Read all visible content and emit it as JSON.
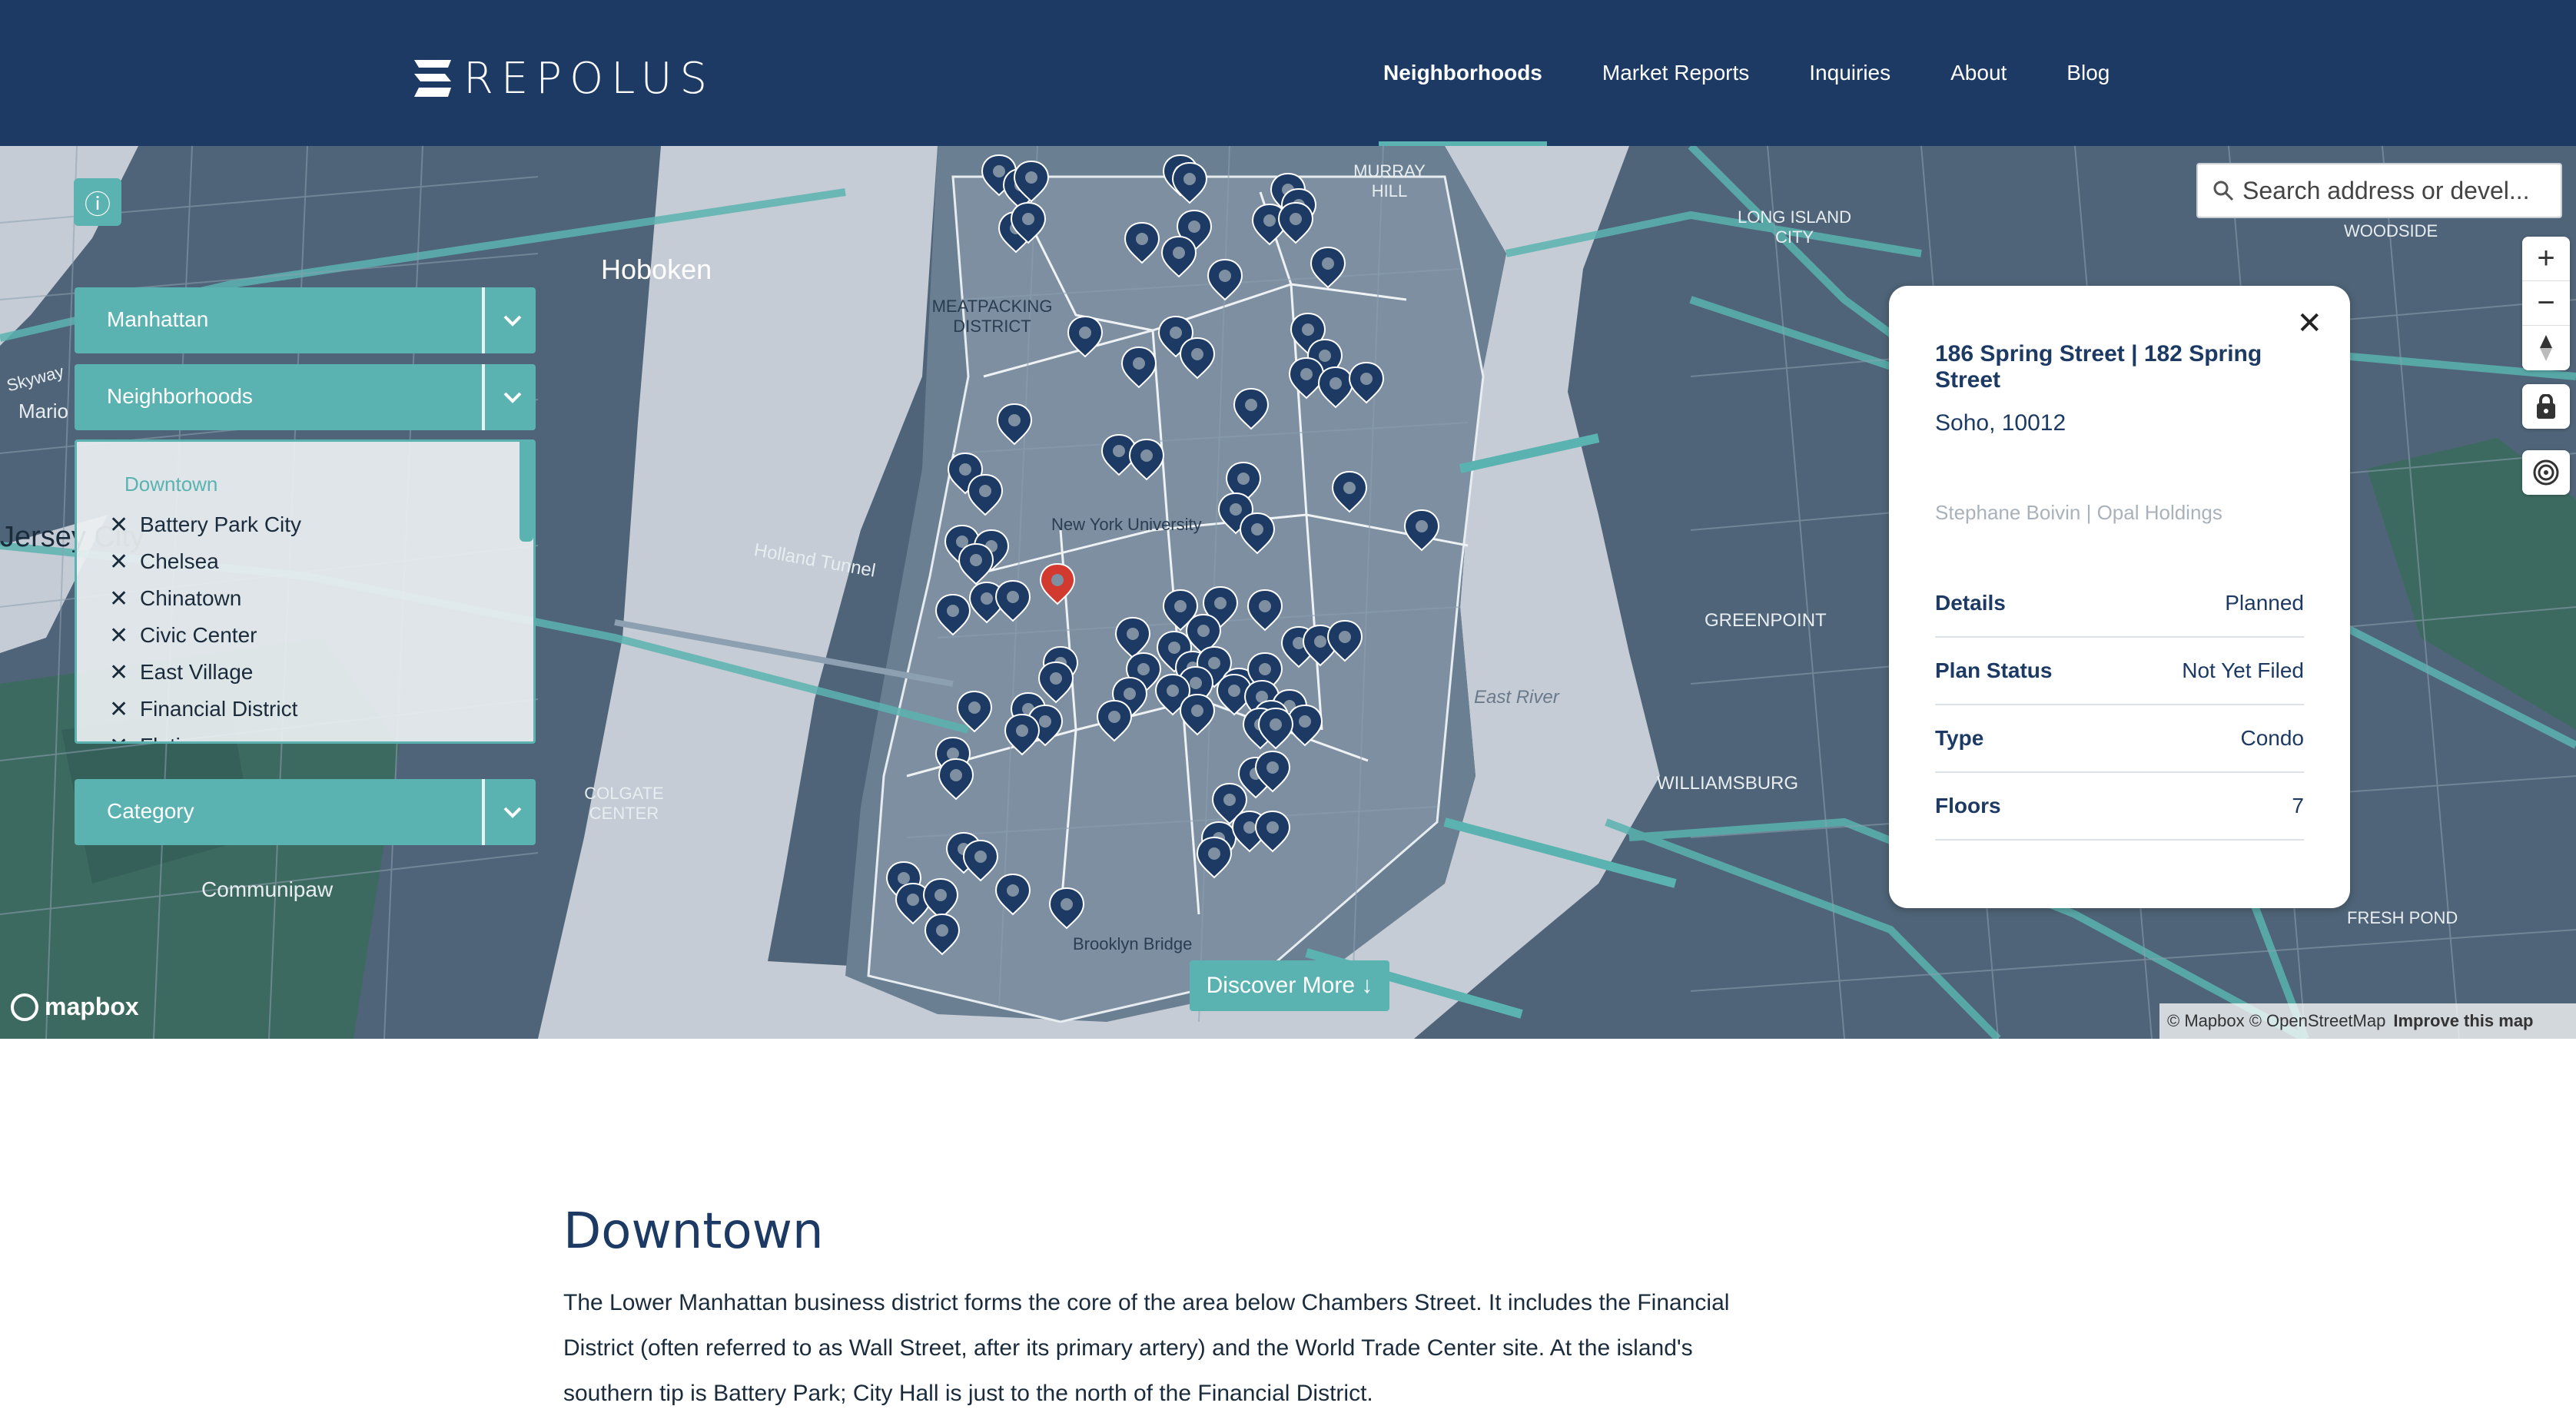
{
  "header": {
    "brand": "REPOLUS",
    "nav": [
      {
        "label": "Neighborhoods",
        "active": true
      },
      {
        "label": "Market Reports",
        "active": false
      },
      {
        "label": "Inquiries",
        "active": false
      },
      {
        "label": "About",
        "active": false
      },
      {
        "label": "Blog",
        "active": false
      }
    ]
  },
  "map": {
    "filters": {
      "borough": "Manhattan",
      "neighborhoods": "Neighborhoods",
      "category": "Category"
    },
    "neighborhood_list": {
      "group": "Downtown",
      "items": [
        "Battery Park City",
        "Chelsea",
        "Chinatown",
        "Civic Center",
        "East Village",
        "Financial District",
        "Flatiron"
      ]
    },
    "search": {
      "placeholder": "Search address or devel..."
    },
    "labels": [
      "Hoboken",
      "MEATPACKING DISTRICT",
      "MURRAY HILL",
      "LONG ISLAND CITY",
      "WOODSIDE",
      "New York University",
      "Holland Tunnel",
      "East River",
      "GREENPOINT",
      "WILLIAMSBURG",
      "COLGATE CENTER",
      "Communipaw",
      "Brooklyn Bridge",
      "FRESH POND",
      "Jersey City",
      "Skyway",
      "Mario"
    ],
    "popup": {
      "title": "186 Spring Street | 182 Spring Street",
      "subtitle": "Soho, 10012",
      "owner": "Stephane Boivin | Opal Holdings",
      "rows": [
        {
          "key": "Details",
          "value": "Planned"
        },
        {
          "key": "Plan Status",
          "value": "Not Yet Filed"
        },
        {
          "key": "Type",
          "value": "Condo"
        },
        {
          "key": "Floors",
          "value": "7"
        }
      ]
    },
    "discover": "Discover More ↓",
    "mapbox": "mapbox",
    "attribution": "© Mapbox © OpenStreetMap",
    "improve": "Improve this map",
    "colors": {
      "accent": "#5ab3b0",
      "navy": "#1c3a63",
      "marker": "#1c3a63",
      "selected_marker": "#d23a2f",
      "land": "#4f6478",
      "water": "#c5ccd5"
    },
    "icons": [
      "info-icon",
      "chevron-down-icon",
      "close-icon",
      "search-icon",
      "zoom-in-icon",
      "zoom-out-icon",
      "compass-icon",
      "lock-icon",
      "geolocate-icon",
      "map-pin-icon"
    ]
  },
  "content": {
    "heading": "Downtown",
    "body": "The Lower Manhattan business district forms the core of the area below Chambers Street. It includes the Financial District (often referred to as Wall Street, after its primary artery) and the World Trade Center site. At the island's southern tip is Battery Park; City Hall is just to the north of the Financial District."
  }
}
